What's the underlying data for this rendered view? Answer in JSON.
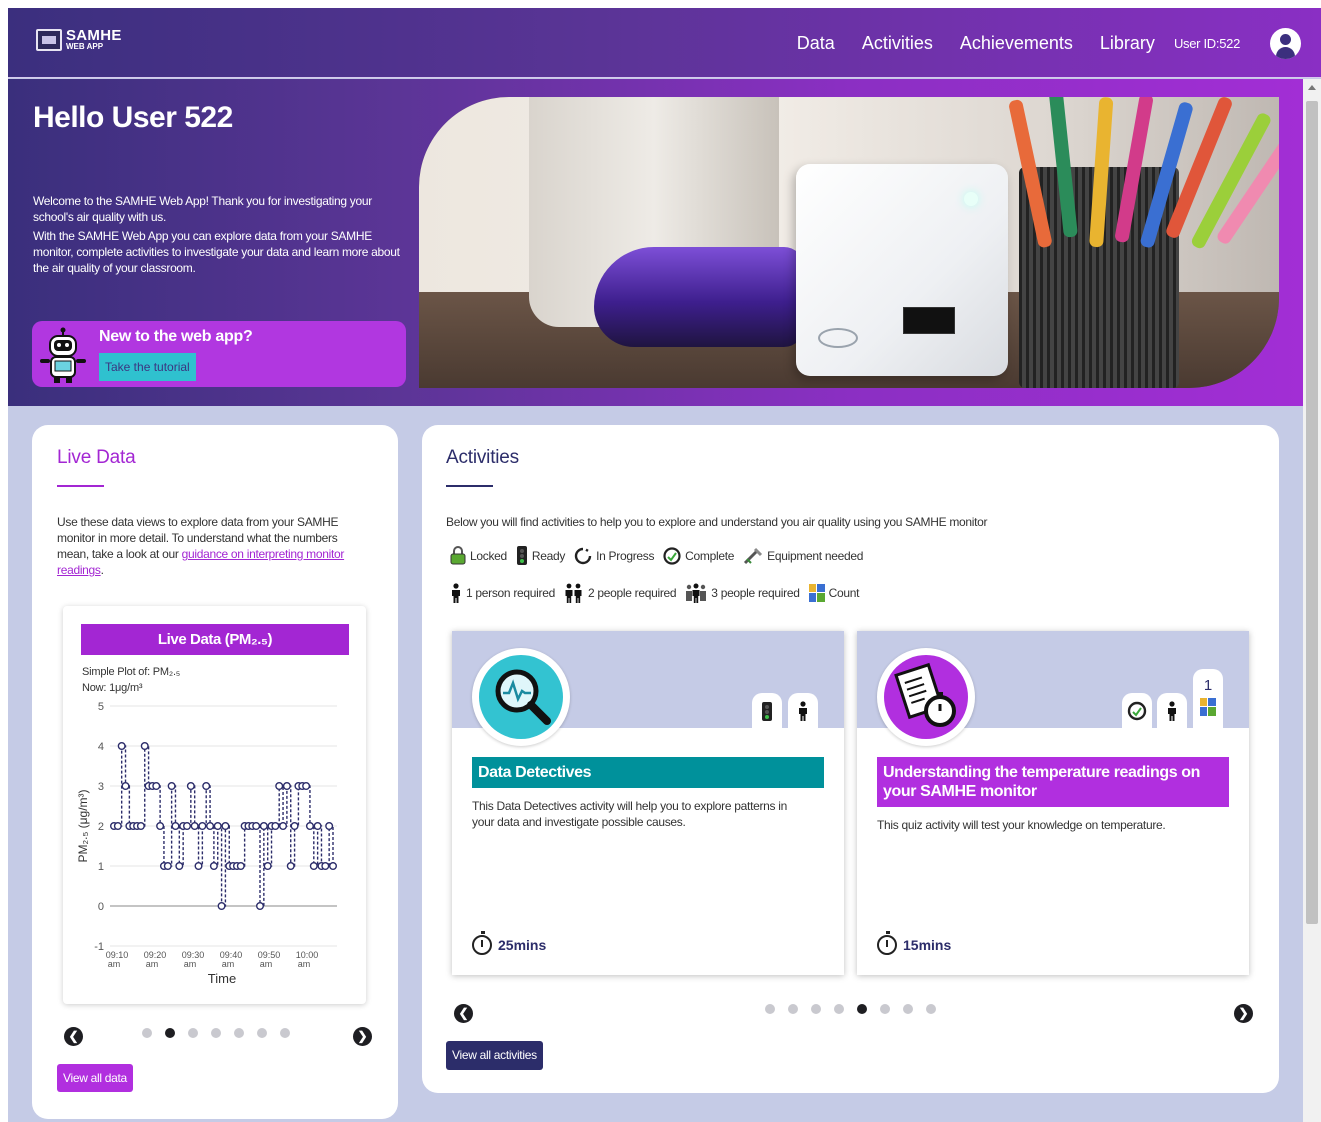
{
  "header": {
    "logo_title": "SAMHE",
    "logo_subtitle": "WEB APP",
    "nav": [
      "Data",
      "Activities",
      "Achievements",
      "Library"
    ],
    "user_id": "User ID:522"
  },
  "hero": {
    "greeting": "Hello User 522",
    "intro_1": "Welcome to the SAMHE Web App! Thank you for investigating your school's air quality with us.",
    "intro_2": "With the SAMHE Web App you can explore data from your SAMHE monitor, complete activities to investigate your data and learn more about the air quality of your classroom.",
    "tutorial_title": "New to the web app?",
    "tutorial_button": "Take the tutorial"
  },
  "live_data": {
    "title": "Live Data",
    "desc_before": "Use these data views to explore data from your SAMHE monitor in more detail. To understand what the numbers mean, take a look at our ",
    "desc_link": "guidance on interpreting monitor readings",
    "desc_after": ".",
    "chart_title": "Live Data (PM₂.₅)",
    "chart_sub_1": "Simple Plot of: PM₂.₅",
    "chart_sub_2": "Now: 1μg/m³",
    "carousel_active": 2,
    "carousel_count": 7,
    "view_all": "View all data"
  },
  "chart_data": {
    "type": "line",
    "title": "Live Data (PM₂.₅)",
    "xlabel": "Time",
    "ylabel": "PM₂.₅ (μg/m³)",
    "ylim": [
      -1,
      5
    ],
    "yticks": [
      "-1",
      "0",
      "1",
      "2",
      "3",
      "4",
      "5"
    ],
    "xticks": [
      [
        "09:10",
        "am"
      ],
      [
        "09:20",
        "am"
      ],
      [
        "09:30",
        "am"
      ],
      [
        "09:40",
        "am"
      ],
      [
        "09:50",
        "am"
      ],
      [
        "10:00",
        "am"
      ]
    ],
    "x_minutes_start": "09:10",
    "series": [
      {
        "values": [
          2,
          2,
          4,
          3,
          2,
          2,
          2,
          2,
          4,
          3,
          3,
          3,
          2,
          1,
          1,
          3,
          2,
          1,
          2,
          2,
          3,
          2,
          1,
          2,
          3,
          2,
          1,
          2,
          0,
          2,
          1,
          1,
          1,
          1,
          2,
          2,
          2,
          2,
          0,
          2,
          1,
          2,
          2,
          3,
          2,
          3,
          1,
          2,
          3,
          3,
          3,
          2,
          1,
          2,
          1,
          1,
          2,
          1
        ]
      }
    ],
    "grid": true,
    "legend": "none"
  },
  "activities": {
    "title": "Activities",
    "desc": "Below you will find activities to help you to explore and understand you air quality using you SAMHE monitor",
    "legend_row_1": [
      {
        "icon": "lock-icon",
        "label": "Locked"
      },
      {
        "icon": "traffic-light-icon",
        "label": "Ready"
      },
      {
        "icon": "in-progress-icon",
        "label": "In Progress"
      },
      {
        "icon": "complete-icon",
        "label": "Complete"
      },
      {
        "icon": "equipment-icon",
        "label": "Equipment needed"
      }
    ],
    "legend_row_2": [
      {
        "icon": "one-person-icon",
        "label": "1 person required"
      },
      {
        "icon": "two-people-icon",
        "label": "2 people required"
      },
      {
        "icon": "three-people-icon",
        "label": "3 people required"
      },
      {
        "icon": "count-icon",
        "label": "Count"
      }
    ],
    "cards": [
      {
        "title": "Data Detectives",
        "desc": "This Data Detectives activity will help you to explore patterns in your data and investigate possible causes.",
        "time": "25mins",
        "color": "#00919b"
      },
      {
        "title": "Understanding the temperature readings on your SAMHE monitor",
        "desc": "This quiz activity will test your knowledge on temperature.",
        "time": "15mins",
        "count": "1",
        "color": "#b12fdf"
      }
    ],
    "carousel_active": 5,
    "carousel_count": 8,
    "view_all": "View all activities"
  },
  "colors": {
    "accent_purple": "#a326d3",
    "navy": "#2c2d6a",
    "teal": "#00919b",
    "page_bg": "#c5cbe6"
  }
}
